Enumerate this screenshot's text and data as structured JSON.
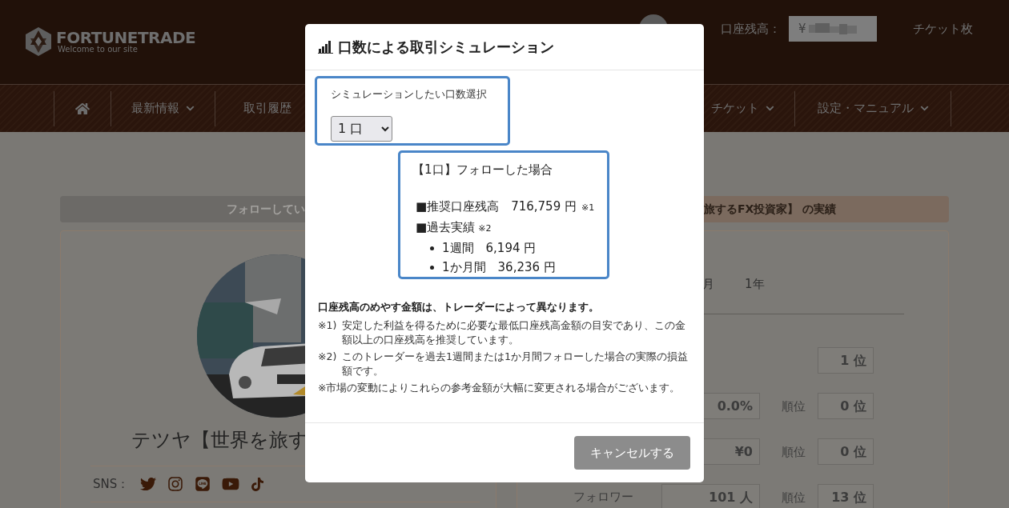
{
  "header": {
    "logo": {
      "name": "FORTUNETRADE",
      "tagline": "Welcome to our site"
    },
    "balance_label": "口座残高：",
    "balance_value": "¥",
    "ticket_label": "チケット枚"
  },
  "nav": [
    {
      "kind": "home"
    },
    {
      "kind": "text",
      "label": "最新情報",
      "dropdown": true
    },
    {
      "kind": "text",
      "label": "取引履歴",
      "dropdown": false
    },
    {
      "kind": "spacer"
    },
    {
      "kind": "text",
      "label": "チケット",
      "dropdown": true
    },
    {
      "kind": "text",
      "label": "設定・マニュアル",
      "dropdown": true
    }
  ],
  "banner": {
    "left": "フォローしてい",
    "right": "旅するFX投資家】 の実績"
  },
  "profile": {
    "name": "テツヤ【世界を旅す",
    "sns_label": "SNS："
  },
  "periods": [
    "月",
    "1年"
  ],
  "stats": [
    {
      "rank": "1 位"
    },
    {
      "value": "0.0%",
      "rank_label": "順位",
      "rank": "0 位"
    },
    {
      "value": "¥0",
      "rank_label": "順位",
      "rank": "0 位"
    },
    {
      "label": "フォロワー",
      "value": "101 人",
      "rank_label": "順位",
      "rank": "13 位"
    }
  ],
  "modal": {
    "title": "口数による取引シミュレーション",
    "select_label": "シミュレーションしたい口数選択",
    "select_value": "1 口",
    "result_heading": "【1口】フォローした場合",
    "recommended": {
      "label": "■推奨口座残高　716,759 円",
      "note": "※1"
    },
    "past": {
      "label": "■過去実績",
      "note": "※2"
    },
    "past_items": [
      "1週間　6,194 円",
      "1か月間　36,236 円"
    ],
    "notes_heading": "口座残高のめやす金額は、トレーダーによって異なります。",
    "notes": [
      {
        "mark": "※1)",
        "text": "安定した利益を得るために必要な最低口座残高金額の目安であり、この金額以上の口座残高を推奨しています。"
      },
      {
        "mark": "※2)",
        "text": "このトレーダーを過去1週間または1か月間フォローした場合の実際の損益額です。"
      },
      {
        "text": "※市場の変動によりこれらの参考金額が大幅に変更される場合がございます。"
      }
    ],
    "cancel": "キャンセルする"
  }
}
